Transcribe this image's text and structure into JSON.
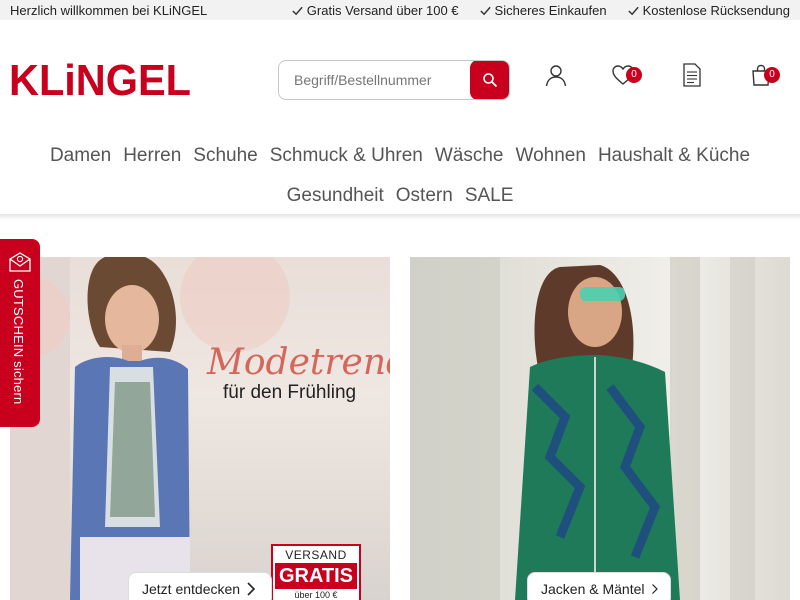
{
  "topbar": {
    "welcome": "Herzlich willkommen bei KLiNGEL",
    "usps": [
      {
        "label": "Gratis Versand über 100 €",
        "icon": "check-icon"
      },
      {
        "label": "Sicheres Einkaufen",
        "icon": "check-icon"
      },
      {
        "label": "Kostenlose Rücksendung",
        "icon": "check-icon"
      }
    ]
  },
  "header": {
    "logo_text": "KLiNGEL",
    "search": {
      "placeholder": "Begriff/Bestellnummer",
      "value": "",
      "button_icon": "search-icon"
    },
    "icons": {
      "account": {
        "icon": "user-icon"
      },
      "wishlist": {
        "icon": "heart-icon",
        "count": "0"
      },
      "catalog_order": {
        "icon": "document-icon"
      },
      "cart": {
        "icon": "shopping-bag-icon",
        "count": "0"
      }
    }
  },
  "nav": {
    "row1": [
      "Damen",
      "Herren",
      "Schuhe",
      "Schmuck & Uhren",
      "Wäsche",
      "Wohnen",
      "Haushalt & Küche"
    ],
    "row2": [
      "Gesundheit",
      "Ostern",
      "SALE"
    ]
  },
  "voucher_tab": {
    "label": "GUTSCHEIN sichern",
    "icon": "envelope-icon"
  },
  "promos": {
    "left": {
      "title": "Modetrends",
      "subtitle": "für den Frühling",
      "badge": {
        "line1": "VERSAND",
        "line2": "GRATIS",
        "line3": "über 100 €"
      },
      "cta": "Jetzt entdecken"
    },
    "right": {
      "cta": "Jacken & Mäntel"
    }
  },
  "colors": {
    "brand_red": "#c8001d",
    "topbar_bg": "#f2f2f2",
    "nav_text": "#555555"
  }
}
